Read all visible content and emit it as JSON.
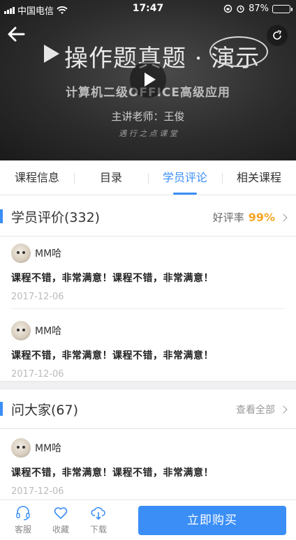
{
  "status_bar": {
    "carrier": "中国电信",
    "time": "17:47",
    "battery": "87%",
    "battery_level": 0.87
  },
  "video": {
    "title": "操作题真题 · 演示",
    "subtitle": "计算机二级OFFICE高级应用",
    "teacher": "主讲老师：王俊",
    "signature": "遇  行  之  点  课  堂"
  },
  "tabs": [
    "课程信息",
    "目录",
    "学员评论",
    "相关课程"
  ],
  "reviews_section": {
    "title": "学员评价(332)",
    "rate_label": "好评率",
    "rate_value": "99%",
    "items": [
      {
        "user": "MM哈",
        "text": "课程不错，非常满意！课程不错，非常满意！",
        "date": "2017-12-06"
      },
      {
        "user": "MM哈",
        "text": "课程不错，非常满意！课程不错，非常满意！",
        "date": "2017-12-06"
      }
    ]
  },
  "qa_section": {
    "title": "问大家(67)",
    "view_all": "查看全部",
    "items": [
      {
        "user": "MM哈",
        "text": "课程不错，非常满意！课程不错，非常满意！",
        "date": "2017-12-06"
      }
    ]
  },
  "bottom_bar": {
    "service": "客服",
    "favorite": "收藏",
    "download": "下载",
    "buy": "立即购买"
  },
  "colors": {
    "accent": "#3a8ef6",
    "rate": "#f5a623"
  },
  "icons": [
    "back-arrow-icon",
    "share-icon",
    "play-icon",
    "headset-icon",
    "heart-icon",
    "cloud-download-icon",
    "chevron-right-icon"
  ]
}
